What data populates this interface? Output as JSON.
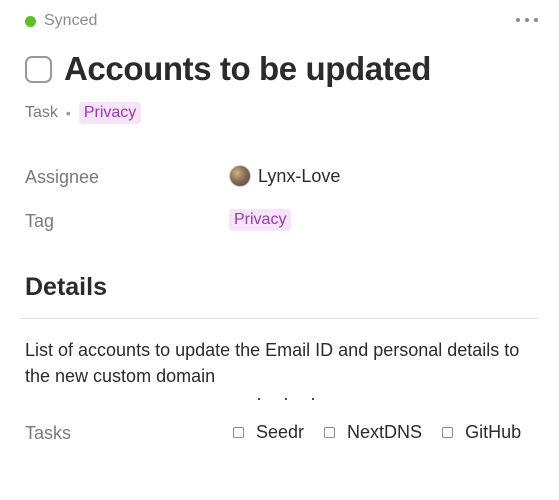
{
  "status": {
    "label": "Synced",
    "color": "#5cbf2a"
  },
  "header": {
    "more_icon": "more-horizontal-icon"
  },
  "task": {
    "title": "Accounts to be updated",
    "type_label": "Task",
    "separator": "•",
    "tag": "Privacy"
  },
  "properties": {
    "assignee_label": "Assignee",
    "assignee_value": "Lynx-Love",
    "tag_label": "Tag",
    "tag_value": "Privacy",
    "tag_color": "#9a3aae",
    "tag_bg": "#f6e4f8"
  },
  "details": {
    "heading": "Details",
    "text": "List of accounts to update the Email ID and personal details to the new custom domain",
    "ellipsis": "· · ·"
  },
  "tasks": {
    "label": "Tasks",
    "items": [
      {
        "label": "Seedr",
        "checked": false
      },
      {
        "label": "NextDNS",
        "checked": false
      },
      {
        "label": "GitHub",
        "checked": false
      }
    ]
  }
}
